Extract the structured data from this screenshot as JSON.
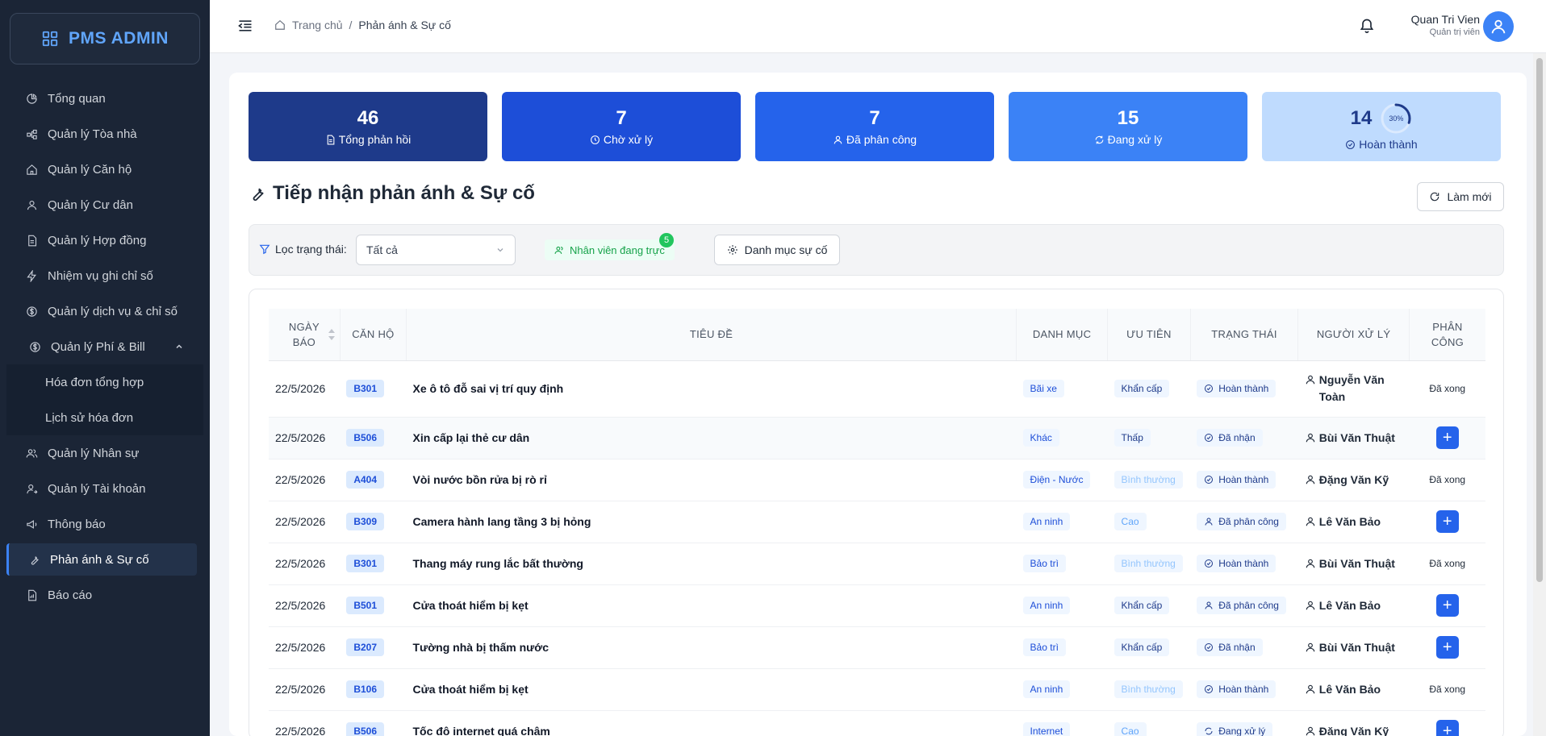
{
  "app": {
    "logo": "PMS ADMIN"
  },
  "sidebar": {
    "items": [
      {
        "label": "Tổng quan",
        "icon": "pie-chart-icon"
      },
      {
        "label": "Quản lý Tòa nhà",
        "icon": "cluster-icon"
      },
      {
        "label": "Quản lý Căn hộ",
        "icon": "home-icon"
      },
      {
        "label": "Quản lý Cư dân",
        "icon": "user-icon"
      },
      {
        "label": "Quản lý Hợp đồng",
        "icon": "file-icon"
      },
      {
        "label": "Nhiệm vụ ghi chỉ số",
        "icon": "thunderbolt-icon"
      },
      {
        "label": "Quản lý dịch vụ & chỉ số",
        "icon": "dollar-icon"
      },
      {
        "label": "Quản lý Phí & Bill",
        "icon": "dollar-circle-icon"
      },
      {
        "label": "Hóa đơn tổng hợp"
      },
      {
        "label": "Lịch sử hóa đơn"
      },
      {
        "label": "Quản lý Nhân sự",
        "icon": "team-icon"
      },
      {
        "label": "Quản lý Tài khoản",
        "icon": "user-switch-icon"
      },
      {
        "label": "Thông báo",
        "icon": "notification-icon"
      },
      {
        "label": "Phản ánh & Sự cố",
        "icon": "tool-icon"
      },
      {
        "label": "Báo cáo",
        "icon": "report-icon"
      }
    ]
  },
  "header": {
    "breadcrumb_home": "Trang chủ",
    "breadcrumb_sep": "/",
    "breadcrumb_current": "Phản ánh & Sự cố",
    "user_name": "Quan Tri Vien",
    "user_role": "Quản trị viên"
  },
  "stats": {
    "total": {
      "value": "46",
      "label": "Tổng phản hồi"
    },
    "pending": {
      "value": "7",
      "label": "Chờ xử lý"
    },
    "assigned": {
      "value": "7",
      "label": "Đã phân công"
    },
    "processing": {
      "value": "15",
      "label": "Đang xử lý"
    },
    "completed": {
      "value": "14",
      "label": "Hoàn thành",
      "percent_text": "30%",
      "progress": 0.3
    }
  },
  "page": {
    "title": "Tiếp nhận phản ánh & Sự cố",
    "refresh_label": "Làm mới"
  },
  "filter": {
    "label": "Lọc trạng thái:",
    "selected": "Tất cả",
    "on_duty_label": "Nhân viên đang trực",
    "on_duty_count": "5",
    "category_button": "Danh mục sự cố"
  },
  "table": {
    "headers": {
      "date_line1": "NGÀY",
      "date_line2": "BÁO",
      "unit": "CĂN HỘ",
      "title": "TIÊU ĐỀ",
      "category": "DANH MỤC",
      "priority": "ƯU TIÊN",
      "status": "TRẠNG THÁI",
      "handler": "NGƯỜI XỬ LÝ",
      "assign_line1": "PHÂN",
      "assign_line2": "CÔNG"
    },
    "rows": [
      {
        "date": "22/5/2026",
        "unit": "B301",
        "title": "Xe ô tô đỗ sai vị trí quy định",
        "category": "Bãi xe",
        "priority": "Khẩn cấp",
        "status": "Hoàn thành",
        "handler": "Nguyễn Văn Toàn",
        "assign": "Đã xong"
      },
      {
        "date": "22/5/2026",
        "unit": "B506",
        "title": "Xin cấp lại thẻ cư dân",
        "category": "Khác",
        "priority": "Thấp",
        "status": "Đã nhận",
        "handler": "Bùi Văn Thuật",
        "assign": "+"
      },
      {
        "date": "22/5/2026",
        "unit": "A404",
        "title": "Vòi nước bồn rửa bị rò rỉ",
        "category": "Điện - Nước",
        "priority": "Bình thường",
        "status": "Hoàn thành",
        "handler": "Đặng Văn Kỹ",
        "assign": "Đã xong"
      },
      {
        "date": "22/5/2026",
        "unit": "B309",
        "title": "Camera hành lang tầng 3 bị hỏng",
        "category": "An ninh",
        "priority": "Cao",
        "status": "Đã phân công",
        "handler": "Lê Văn Bảo",
        "assign": "+"
      },
      {
        "date": "22/5/2026",
        "unit": "B301",
        "title": "Thang máy rung lắc bất thường",
        "category": "Bảo trì",
        "priority": "Bình thường",
        "status": "Hoàn thành",
        "handler": "Bùi Văn Thuật",
        "assign": "Đã xong"
      },
      {
        "date": "22/5/2026",
        "unit": "B501",
        "title": "Cửa thoát hiểm bị kẹt",
        "category": "An ninh",
        "priority": "Khẩn cấp",
        "status": "Đã phân công",
        "handler": "Lê Văn Bảo",
        "assign": "+"
      },
      {
        "date": "22/5/2026",
        "unit": "B207",
        "title": "Tường nhà bị thấm nước",
        "category": "Bảo trì",
        "priority": "Khẩn cấp",
        "status": "Đã nhận",
        "handler": "Bùi Văn Thuật",
        "assign": "+"
      },
      {
        "date": "22/5/2026",
        "unit": "B106",
        "title": "Cửa thoát hiểm bị kẹt",
        "category": "An ninh",
        "priority": "Bình thường",
        "status": "Hoàn thành",
        "handler": "Lê Văn Bảo",
        "assign": "Đã xong"
      },
      {
        "date": "22/5/2026",
        "unit": "B506",
        "title": "Tốc độ internet quá chậm",
        "category": "Internet",
        "priority": "Cao",
        "status": "Đang xử lý",
        "handler": "Đặng Văn Kỹ",
        "assign": "+"
      }
    ]
  }
}
